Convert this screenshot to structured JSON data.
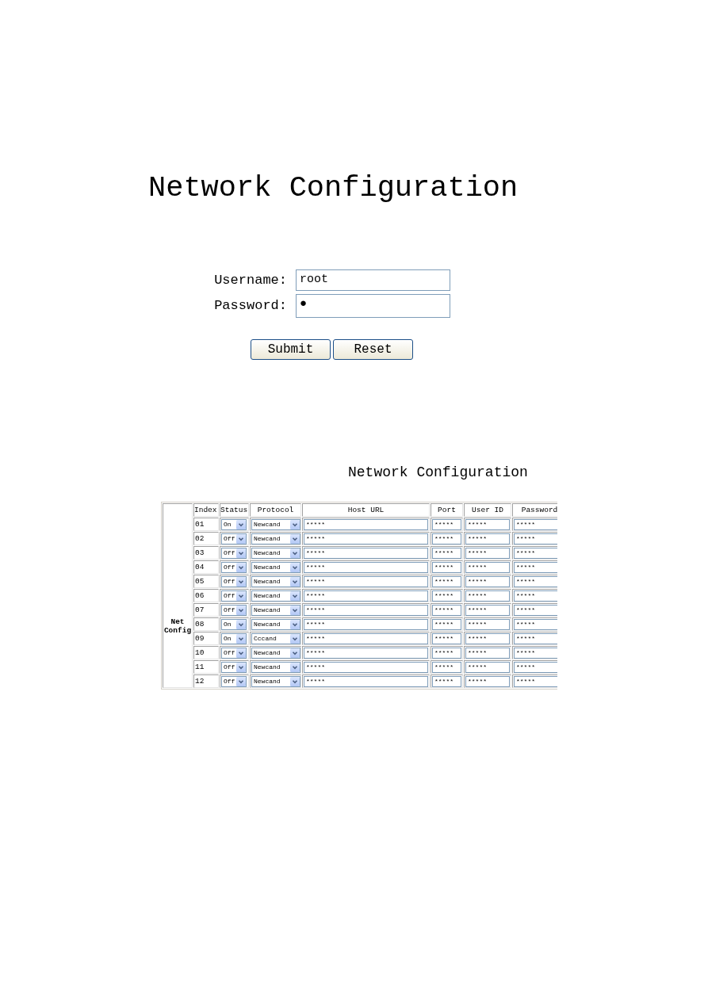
{
  "login": {
    "title": "Network Configuration",
    "fields": [
      {
        "label": "Username:",
        "value": "root"
      },
      {
        "label": "Password:",
        "value": "●"
      }
    ],
    "buttons": [
      "Submit",
      "Reset"
    ]
  },
  "net_config": {
    "title": "Network Configuration",
    "group_label": "Net Config",
    "columns": [
      "Index",
      "Status",
      "Protocol",
      "Host URL",
      "Port",
      "User ID",
      "Password"
    ],
    "rows": [
      {
        "index": "01",
        "status": "On",
        "protocol": "Newcand",
        "host_url": "*****",
        "port": "*****",
        "user_id": "*****",
        "password": "*****"
      },
      {
        "index": "02",
        "status": "Off",
        "protocol": "Newcand",
        "host_url": "*****",
        "port": "*****",
        "user_id": "*****",
        "password": "*****"
      },
      {
        "index": "03",
        "status": "Off",
        "protocol": "Newcand",
        "host_url": "*****",
        "port": "*****",
        "user_id": "*****",
        "password": "*****"
      },
      {
        "index": "04",
        "status": "Off",
        "protocol": "Newcand",
        "host_url": "*****",
        "port": "*****",
        "user_id": "*****",
        "password": "*****"
      },
      {
        "index": "05",
        "status": "Off",
        "protocol": "Newcand",
        "host_url": "*****",
        "port": "*****",
        "user_id": "*****",
        "password": "*****"
      },
      {
        "index": "06",
        "status": "Off",
        "protocol": "Newcand",
        "host_url": "*****",
        "port": "*****",
        "user_id": "*****",
        "password": "*****"
      },
      {
        "index": "07",
        "status": "Off",
        "protocol": "Newcand",
        "host_url": "*****",
        "port": "*****",
        "user_id": "*****",
        "password": "*****"
      },
      {
        "index": "08",
        "status": "On",
        "protocol": "Newcand",
        "host_url": "*****",
        "port": "*****",
        "user_id": "*****",
        "password": "*****"
      },
      {
        "index": "09",
        "status": "On",
        "protocol": "Cccand",
        "host_url": "*****",
        "port": "*****",
        "user_id": "*****",
        "password": "*****"
      },
      {
        "index": "10",
        "status": "Off",
        "protocol": "Newcand",
        "host_url": "*****",
        "port": "*****",
        "user_id": "*****",
        "password": "*****"
      },
      {
        "index": "11",
        "status": "Off",
        "protocol": "Newcand",
        "host_url": "*****",
        "port": "*****",
        "user_id": "*****",
        "password": "*****"
      },
      {
        "index": "12",
        "status": "Off",
        "protocol": "Newcand",
        "host_url": "*****",
        "port": "*****",
        "user_id": "*****",
        "password": "*****"
      }
    ]
  }
}
